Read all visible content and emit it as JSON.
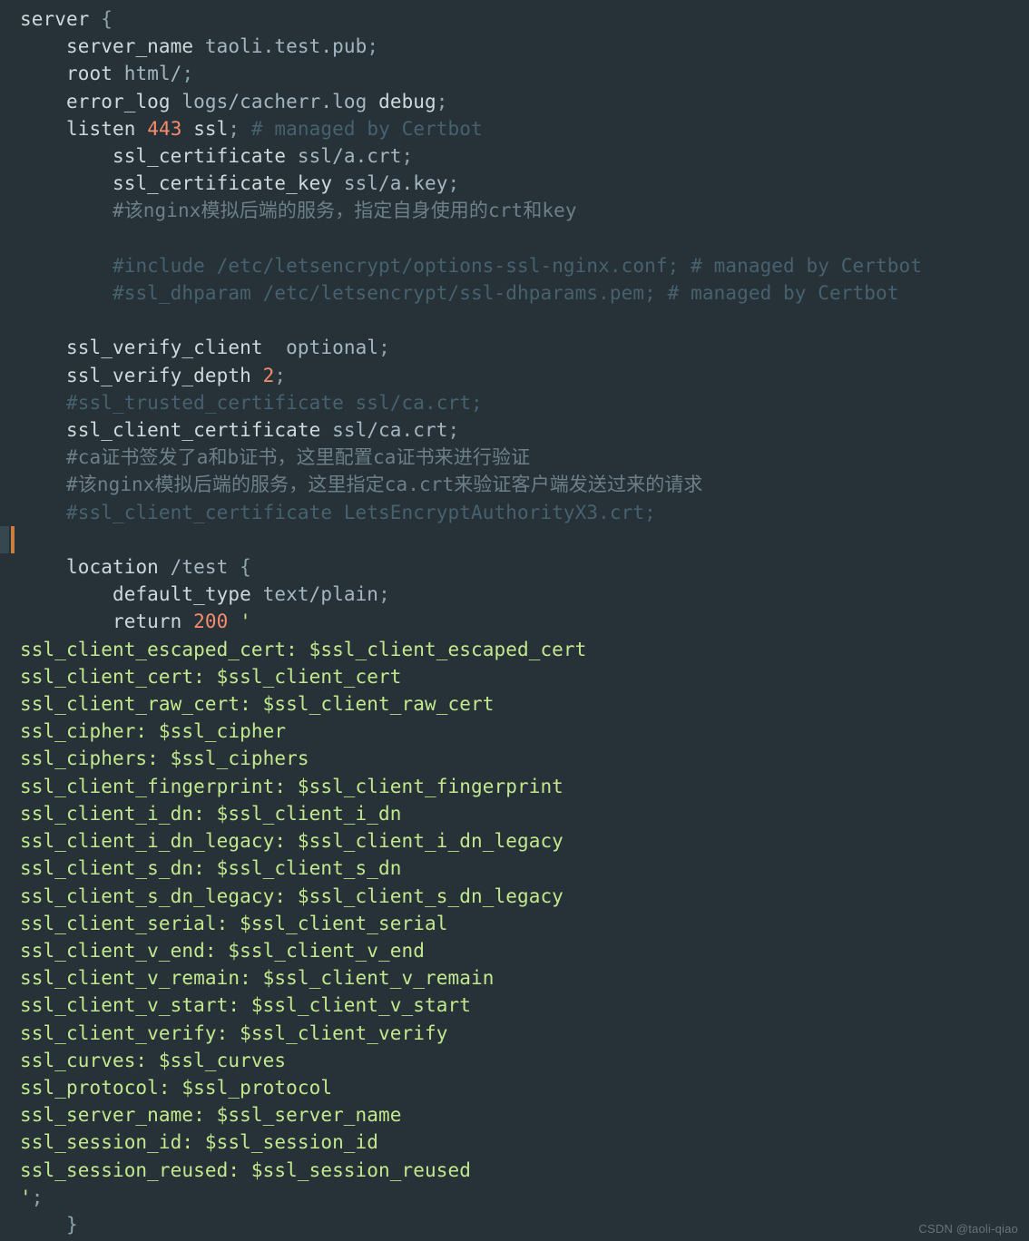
{
  "editor": {
    "theme_bg": "#263238",
    "accent_bar": "#c97f3d",
    "highlighted_line_index": 19
  },
  "code": {
    "lines": [
      [
        [
          "t-dir",
          "server"
        ],
        [
          "t-default",
          " "
        ],
        [
          "t-punct",
          "{"
        ]
      ],
      [
        [
          "t-default",
          "    "
        ],
        [
          "t-dir",
          "server_name"
        ],
        [
          "t-default",
          " taoli.test.pub"
        ],
        [
          "t-punct",
          ";"
        ]
      ],
      [
        [
          "t-default",
          "    "
        ],
        [
          "t-dir",
          "root"
        ],
        [
          "t-default",
          " html/"
        ],
        [
          "t-punct",
          ";"
        ]
      ],
      [
        [
          "t-default",
          "    "
        ],
        [
          "t-dir",
          "error_log"
        ],
        [
          "t-default",
          " logs/cacherr.log "
        ],
        [
          "t-dir",
          "debug"
        ],
        [
          "t-punct",
          ";"
        ]
      ],
      [
        [
          "t-default",
          "    "
        ],
        [
          "t-dir",
          "listen"
        ],
        [
          "t-default",
          " "
        ],
        [
          "t-num",
          "443"
        ],
        [
          "t-default",
          " "
        ],
        [
          "t-dir",
          "ssl"
        ],
        [
          "t-punct",
          ";"
        ],
        [
          "t-default",
          " "
        ],
        [
          "t-comment",
          "# managed by Certbot"
        ]
      ],
      [
        [
          "t-default",
          "        "
        ],
        [
          "t-dir",
          "ssl_certificate"
        ],
        [
          "t-default",
          " ssl/a.crt"
        ],
        [
          "t-punct",
          ";"
        ]
      ],
      [
        [
          "t-default",
          "        "
        ],
        [
          "t-dir",
          "ssl_certificate_key"
        ],
        [
          "t-default",
          " ssl/a.key"
        ],
        [
          "t-punct",
          ";"
        ]
      ],
      [
        [
          "t-default",
          "        "
        ],
        [
          "t-cjkcom",
          "#该nginx模拟后端的服务，指定自身使用的crt和key"
        ]
      ],
      [
        [
          "t-default",
          " "
        ]
      ],
      [
        [
          "t-default",
          "        "
        ],
        [
          "t-comment",
          "#include /etc/letsencrypt/options-ssl-nginx.conf; # managed by Certbot"
        ]
      ],
      [
        [
          "t-default",
          "        "
        ],
        [
          "t-comment",
          "#ssl_dhparam /etc/letsencrypt/ssl-dhparams.pem; # managed by Certbot"
        ]
      ],
      [
        [
          "t-default",
          " "
        ]
      ],
      [
        [
          "t-default",
          "    "
        ],
        [
          "t-dir",
          "ssl_verify_client"
        ],
        [
          "t-default",
          "  optional"
        ],
        [
          "t-punct",
          ";"
        ]
      ],
      [
        [
          "t-default",
          "    "
        ],
        [
          "t-dir",
          "ssl_verify_depth"
        ],
        [
          "t-default",
          " "
        ],
        [
          "t-num",
          "2"
        ],
        [
          "t-punct",
          ";"
        ]
      ],
      [
        [
          "t-default",
          "    "
        ],
        [
          "t-comment",
          "#ssl_trusted_certificate ssl/ca.crt;"
        ]
      ],
      [
        [
          "t-default",
          "    "
        ],
        [
          "t-dir",
          "ssl_client_certificate"
        ],
        [
          "t-default",
          " ssl/ca.crt"
        ],
        [
          "t-punct",
          ";"
        ]
      ],
      [
        [
          "t-default",
          "    "
        ],
        [
          "t-cjkcom",
          "#ca证书签发了a和b证书，这里配置ca证书来进行验证"
        ]
      ],
      [
        [
          "t-default",
          "    "
        ],
        [
          "t-cjkcom",
          "#该nginx模拟后端的服务，这里指定ca.crt来验证客户端发送过来的请求"
        ]
      ],
      [
        [
          "t-default",
          "    "
        ],
        [
          "t-comment",
          "#ssl_client_certificate LetsEncryptAuthorityX3.crt;"
        ]
      ],
      [
        [
          "t-default",
          " "
        ]
      ],
      [
        [
          "t-default",
          "    "
        ],
        [
          "t-dir",
          "location"
        ],
        [
          "t-default",
          " /test "
        ],
        [
          "t-punct",
          "{"
        ]
      ],
      [
        [
          "t-default",
          "        "
        ],
        [
          "t-dir",
          "default_type"
        ],
        [
          "t-default",
          " text/plain"
        ],
        [
          "t-punct",
          ";"
        ]
      ],
      [
        [
          "t-default",
          "        "
        ],
        [
          "t-dir",
          "return"
        ],
        [
          "t-default",
          " "
        ],
        [
          "t-num",
          "200"
        ],
        [
          "t-default",
          " "
        ],
        [
          "t-string",
          "'"
        ]
      ],
      [
        [
          "t-string",
          "ssl_client_escaped_cert: $ssl_client_escaped_cert"
        ]
      ],
      [
        [
          "t-string",
          "ssl_client_cert: $ssl_client_cert"
        ]
      ],
      [
        [
          "t-string",
          "ssl_client_raw_cert: $ssl_client_raw_cert"
        ]
      ],
      [
        [
          "t-string",
          "ssl_cipher: $ssl_cipher"
        ]
      ],
      [
        [
          "t-string",
          "ssl_ciphers: $ssl_ciphers"
        ]
      ],
      [
        [
          "t-string",
          "ssl_client_fingerprint: $ssl_client_fingerprint"
        ]
      ],
      [
        [
          "t-string",
          "ssl_client_i_dn: $ssl_client_i_dn"
        ]
      ],
      [
        [
          "t-string",
          "ssl_client_i_dn_legacy: $ssl_client_i_dn_legacy"
        ]
      ],
      [
        [
          "t-string",
          "ssl_client_s_dn: $ssl_client_s_dn"
        ]
      ],
      [
        [
          "t-string",
          "ssl_client_s_dn_legacy: $ssl_client_s_dn_legacy"
        ]
      ],
      [
        [
          "t-string",
          "ssl_client_serial: $ssl_client_serial"
        ]
      ],
      [
        [
          "t-string",
          "ssl_client_v_end: $ssl_client_v_end"
        ]
      ],
      [
        [
          "t-string",
          "ssl_client_v_remain: $ssl_client_v_remain"
        ]
      ],
      [
        [
          "t-string",
          "ssl_client_v_start: $ssl_client_v_start"
        ]
      ],
      [
        [
          "t-string",
          "ssl_client_verify: $ssl_client_verify"
        ]
      ],
      [
        [
          "t-string",
          "ssl_curves: $ssl_curves"
        ]
      ],
      [
        [
          "t-string",
          "ssl_protocol: $ssl_protocol"
        ]
      ],
      [
        [
          "t-string",
          "ssl_server_name: $ssl_server_name"
        ]
      ],
      [
        [
          "t-string",
          "ssl_session_id: $ssl_session_id"
        ]
      ],
      [
        [
          "t-string",
          "ssl_session_reused: $ssl_session_reused"
        ]
      ],
      [
        [
          "t-string",
          "'"
        ],
        [
          "t-punct",
          ";"
        ]
      ],
      [
        [
          "t-default",
          "    "
        ],
        [
          "t-punct",
          "}"
        ]
      ]
    ]
  },
  "watermark": "CSDN @taoli-qiao"
}
